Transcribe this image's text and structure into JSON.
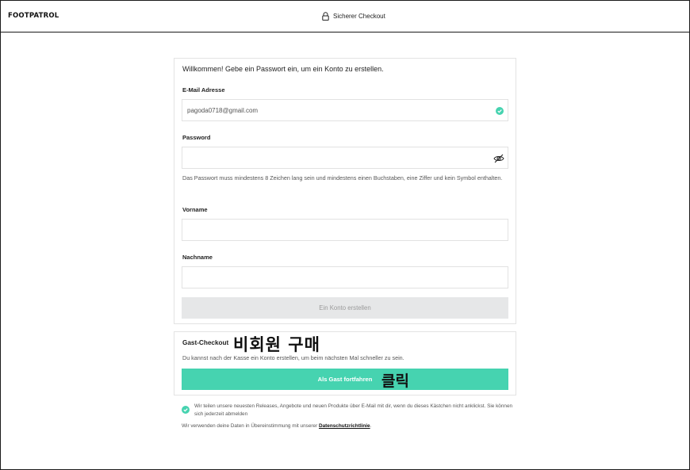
{
  "header": {
    "logo": "FOOTPATROL",
    "secure_checkout": "Sicherer Checkout",
    "lock_icon": "lock-icon"
  },
  "register": {
    "welcome": "Willkommen! Gebe ein Passwort ein, um ein Konto zu erstellen.",
    "email_label": "E-Mail Adresse",
    "email_value": "pagoda0718@gmail.com",
    "email_valid_icon": "check-circle-icon",
    "password_label": "Password",
    "password_value": "",
    "password_toggle_icon": "eye-off-icon",
    "password_hint": "Das Passwort muss mindestens 8 Zeichen lang sein und mindestens einen Buchstaben, eine Ziffer und kein Symbol enthalten.",
    "firstname_label": "Vorname",
    "firstname_value": "",
    "lastname_label": "Nachname",
    "lastname_value": "",
    "create_button": "Ein Konto erstellen"
  },
  "guest": {
    "title": "Gast-Checkout",
    "annotation": "비회원 구매",
    "description": "Du kannst nach der Kasse ein Konto erstellen, um beim nächsten Mal schneller zu sein.",
    "button": "Als Gast fortfahren",
    "button_annotation": "클릭"
  },
  "consent": {
    "text": "Wir teilen unsere neuesten Releases, Angebote und neuen Produkte über E-Mail mit dir, wenn du dieses Kästchen nicht anklickst. Sie können sich jederzeit abmelden",
    "privacy_prefix": "Wir verwenden deine Daten in Übereinstimmung mit unserer",
    "privacy_link": "Datenschutzrichtlinie",
    "privacy_suffix": "."
  },
  "colors": {
    "accent": "#46d3b0",
    "disabled_button": "#e6e7e8"
  }
}
